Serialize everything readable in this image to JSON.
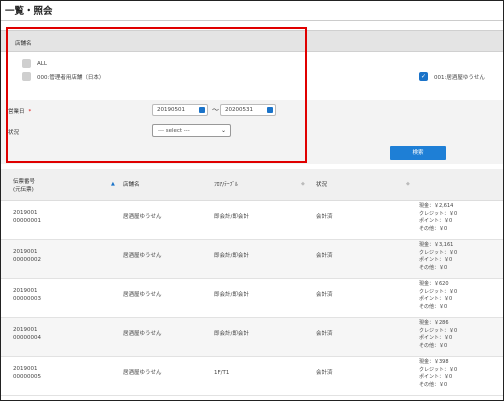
{
  "page": {
    "title": "一覧・照会"
  },
  "filter": {
    "shop_section_label": "店舗名",
    "shop_options": [
      {
        "label": "ALL",
        "checked": false
      },
      {
        "label": "000:管理者用店舗（日本）",
        "checked": false
      },
      {
        "label": "001:居酒屋ゆうせん",
        "checked": true
      }
    ],
    "business_date_label": "営業日",
    "required_mark": "*",
    "date_from": "20190501",
    "date_to": "20200531",
    "date_separator": "～",
    "status_label": "状況",
    "status_select": "--- select ---",
    "search_button": "検索"
  },
  "table": {
    "headers": {
      "slip_no_line1": "伝票番号",
      "slip_no_line2": "(元伝票)",
      "shop": "店舗名",
      "floor_table": "ﾌﾛｱ/ﾃｰﾌﾞﾙ",
      "status": "状況"
    },
    "rows": [
      {
        "slip_line1": "2019001",
        "slip_line2": "00000001",
        "shop": "居酒屋ゆうせん",
        "floor_table": "即会計/即会計",
        "status": "会計済",
        "amounts": [
          "現金：￥2,614",
          "クレジット：￥0",
          "ポイント：￥0",
          "その他：￥0"
        ]
      },
      {
        "slip_line1": "2019001",
        "slip_line2": "00000002",
        "shop": "居酒屋ゆうせん",
        "floor_table": "即会計/即会計",
        "status": "会計済",
        "amounts": [
          "現金：￥3,161",
          "クレジット：￥0",
          "ポイント：￥0",
          "その他：￥0"
        ]
      },
      {
        "slip_line1": "2019001",
        "slip_line2": "00000003",
        "shop": "居酒屋ゆうせん",
        "floor_table": "即会計/即会計",
        "status": "会計済",
        "amounts": [
          "現金：￥620",
          "クレジット：￥0",
          "ポイント：￥0",
          "その他：￥0"
        ]
      },
      {
        "slip_line1": "2019001",
        "slip_line2": "00000004",
        "shop": "居酒屋ゆうせん",
        "floor_table": "即会計/即会計",
        "status": "会計済",
        "amounts": [
          "現金：￥286",
          "クレジット：￥0",
          "ポイント：￥0",
          "その他：￥0"
        ]
      },
      {
        "slip_line1": "2019001",
        "slip_line2": "00000005",
        "shop": "居酒屋ゆうせん",
        "floor_table": "1F/T1",
        "status": "会計済",
        "amounts": [
          "現金：￥398",
          "クレジット：￥0",
          "ポイント：￥0",
          "その他：￥0"
        ]
      }
    ]
  },
  "colors": {
    "highlight": "#e00000",
    "accent": "#1e7fd6"
  },
  "icons": {
    "checkbox_checked": "check-icon",
    "calendar": "calendar-icon",
    "sort": "sort-icon",
    "dropdown": "chevron-down-icon"
  }
}
